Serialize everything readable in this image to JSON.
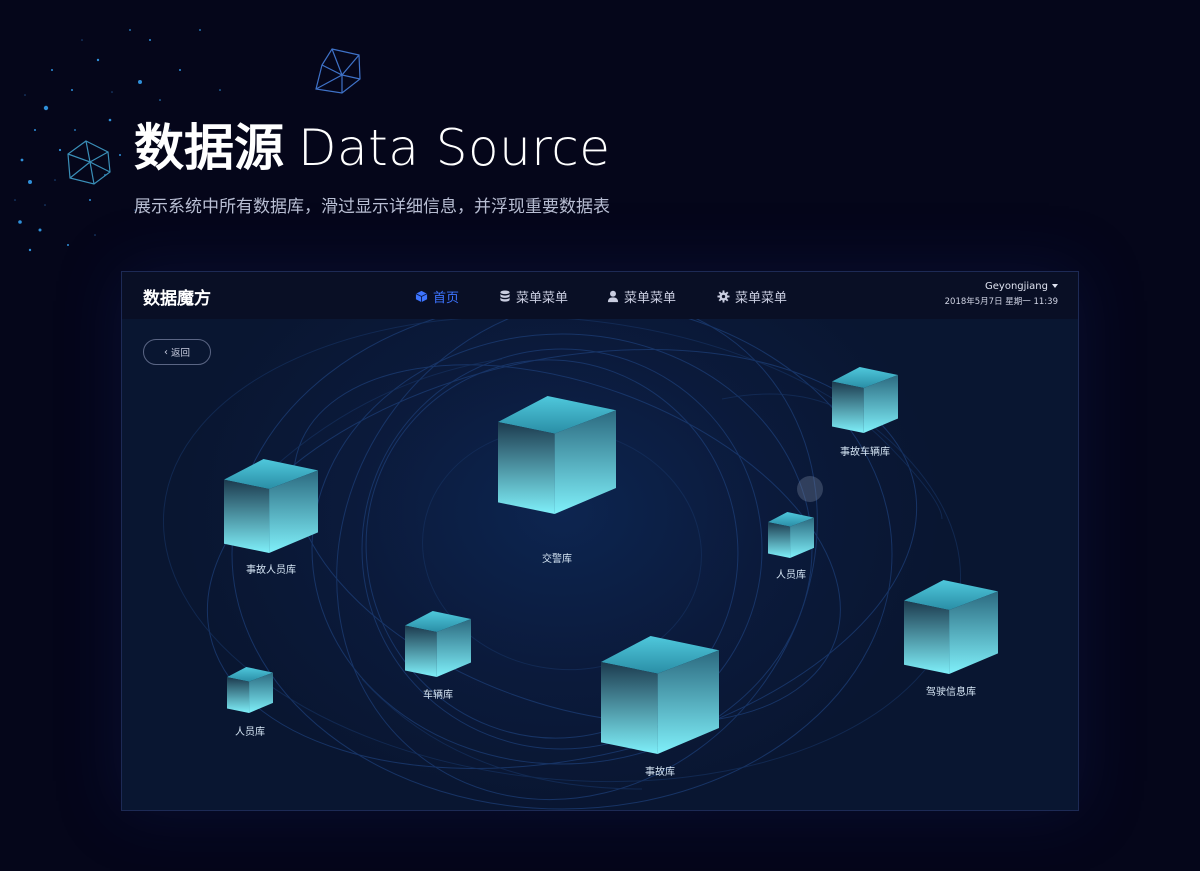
{
  "hero": {
    "title_cn": "数据源",
    "title_en": "Data Source",
    "subtitle": "展示系统中所有数据库，滑过显示详细信息，并浮现重要数据表"
  },
  "app": {
    "brand": "数据魔方",
    "nav": [
      {
        "label": "首页",
        "icon": "cube-icon",
        "active": true
      },
      {
        "label": "菜单菜单",
        "icon": "database-icon",
        "active": false
      },
      {
        "label": "菜单菜单",
        "icon": "user-icon",
        "active": false
      },
      {
        "label": "菜单菜单",
        "icon": "gear-icon",
        "active": false
      }
    ],
    "user": {
      "name": "Geyongjiang",
      "datetime": "2018年5月7日  星期一  11:39"
    },
    "back_label": "返回",
    "colors": {
      "accent": "#3d74ff",
      "cube_light": "#7ff0fa",
      "cube_dark": "#1c3a4e",
      "background": "#05061a"
    },
    "databases": [
      {
        "label": "事故车辆库"
      },
      {
        "label": "事故人员库"
      },
      {
        "label": "交警库"
      },
      {
        "label": "人员库"
      },
      {
        "label": "驾驶信息库"
      },
      {
        "label": "车辆库"
      },
      {
        "label": "人员库"
      },
      {
        "label": "事故库"
      }
    ]
  }
}
